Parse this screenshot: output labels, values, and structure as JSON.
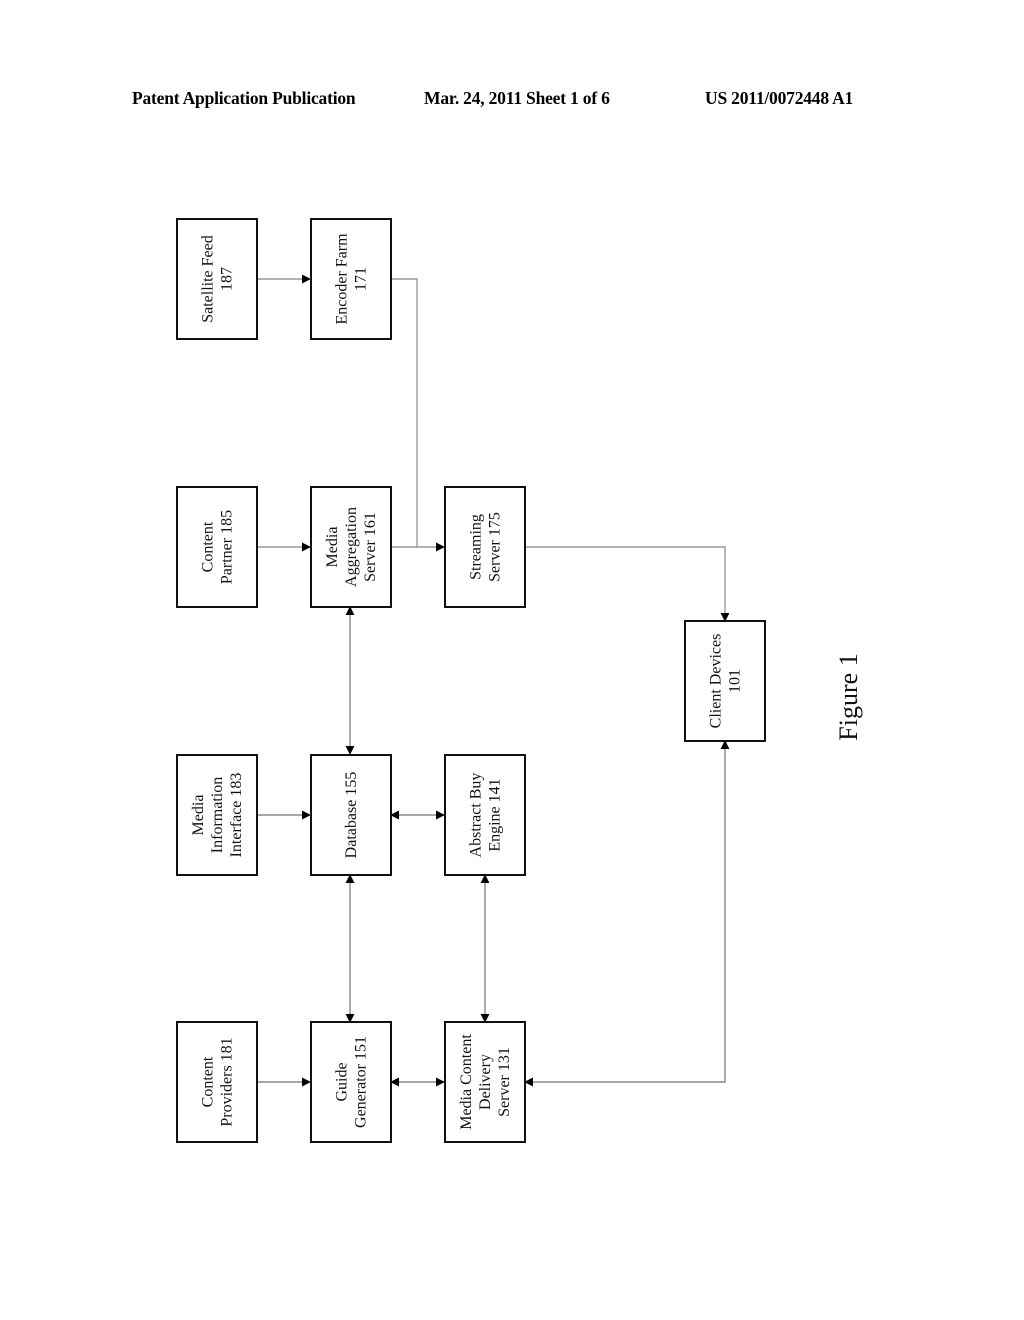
{
  "header": {
    "left": "Patent Application Publication",
    "middle": "Mar. 24, 2011  Sheet 1 of 6",
    "right": "US 2011/0072448 A1"
  },
  "figure_label": "Figure 1",
  "boxes": {
    "satellite_feed": [
      "Satellite Feed",
      "187"
    ],
    "encoder_farm": [
      "Encoder Farm",
      "171"
    ],
    "content_partner": [
      "Content",
      "Partner 185"
    ],
    "media_aggregation_server": [
      "Media",
      "Aggregation",
      "Server 161"
    ],
    "streaming_server": [
      "Streaming",
      "Server 175"
    ],
    "media_information_interface": [
      "Media",
      "Information",
      "Interface 183"
    ],
    "database": [
      "Database 155"
    ],
    "abstract_buy_engine": [
      "Abstract Buy",
      "Engine 141"
    ],
    "content_providers": [
      "Content",
      "Providers 181"
    ],
    "guide_generator": [
      "Guide",
      "Generator 151"
    ],
    "media_content_delivery_server": [
      "Media Content",
      "Delivery",
      "Server 131"
    ],
    "client_devices": [
      "Client Devices",
      "101"
    ]
  },
  "connections": [
    {
      "from": "satellite_feed",
      "to": "encoder_farm",
      "direction": "one-way"
    },
    {
      "from": "encoder_farm",
      "to": "streaming_server",
      "direction": "one-way"
    },
    {
      "from": "content_partner",
      "to": "media_aggregation_server",
      "direction": "one-way"
    },
    {
      "from": "media_aggregation_server",
      "to": "streaming_server",
      "direction": "one-way"
    },
    {
      "from": "streaming_server",
      "to": "client_devices",
      "direction": "one-way"
    },
    {
      "from": "media_aggregation_server",
      "to": "database",
      "direction": "two-way"
    },
    {
      "from": "media_information_interface",
      "to": "database",
      "direction": "one-way"
    },
    {
      "from": "database",
      "to": "abstract_buy_engine",
      "direction": "two-way"
    },
    {
      "from": "database",
      "to": "guide_generator",
      "direction": "two-way"
    },
    {
      "from": "abstract_buy_engine",
      "to": "media_content_delivery_server",
      "direction": "two-way"
    },
    {
      "from": "content_providers",
      "to": "guide_generator",
      "direction": "one-way"
    },
    {
      "from": "guide_generator",
      "to": "media_content_delivery_server",
      "direction": "two-way"
    },
    {
      "from": "media_content_delivery_server",
      "to": "client_devices",
      "direction": "two-way"
    }
  ]
}
